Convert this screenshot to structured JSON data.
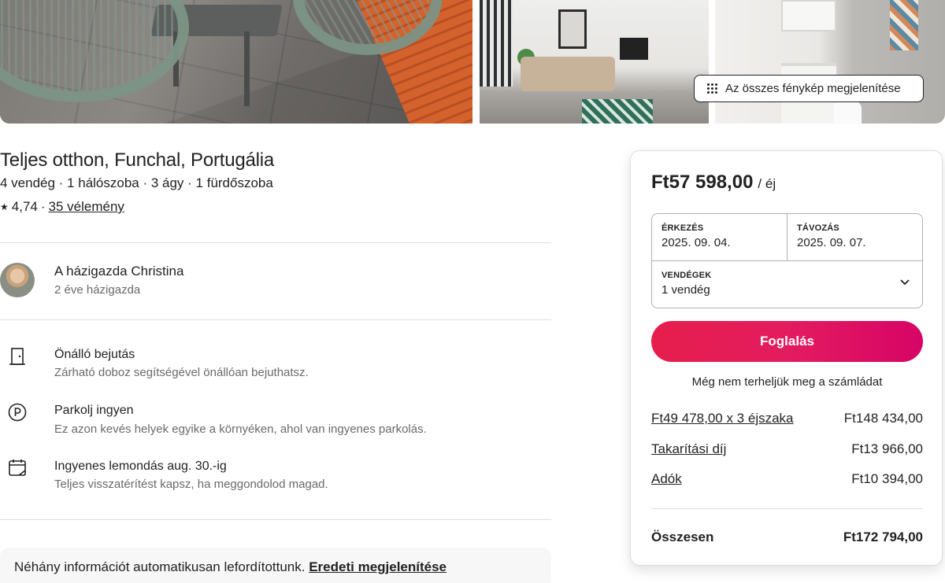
{
  "photos": {
    "show_all_label": "Az összes fénykép megjelenítése"
  },
  "listing": {
    "title": "Teljes otthon, Funchal, Portugália",
    "subtitle": "4 vendég · 1 hálószoba · 3 ágy · 1 fürdőszoba",
    "rating": "4,74",
    "separator": "·",
    "reviews_link": "35 vélemény"
  },
  "host": {
    "name": "A házigazda Christina",
    "tenure": "2 éve házigazda"
  },
  "features": [
    {
      "icon": "door-icon",
      "title": "Önálló bejutás",
      "desc": "Zárható doboz segítségével önállóan bejuthatsz."
    },
    {
      "icon": "parking-icon",
      "title": "Parkolj ingyen",
      "desc": "Ez azon kevés helyek egyike a környéken, ahol van ingyenes parkolás."
    },
    {
      "icon": "calendar-icon",
      "title": "Ingyenes lemondás aug. 30.-ig",
      "desc": "Teljes visszatérítést kapsz, ha meggondolod magad."
    }
  ],
  "translation": {
    "notice": "Néhány információt automatikusan lefordítottunk.",
    "show_original": "Eredeti megjelenítése"
  },
  "booking": {
    "price": "Ft57 598,00",
    "price_unit": "/ éj",
    "checkin_label": "ÉRKEZÉS",
    "checkin_value": "2025. 09. 04.",
    "checkout_label": "TÁVOZÁS",
    "checkout_value": "2025. 09. 07.",
    "guests_label": "VENDÉGEK",
    "guests_value": "1 vendég",
    "reserve_label": "Foglalás",
    "no_charge_note": "Még nem terheljük meg a számládat",
    "fees": [
      {
        "label": "Ft49 478,00 x 3 éjszaka",
        "amount": "Ft148 434,00"
      },
      {
        "label": "Takarítási díj",
        "amount": "Ft13 966,00"
      },
      {
        "label": "Adók",
        "amount": "Ft10 394,00"
      }
    ],
    "total_label": "Összesen",
    "total_amount": "Ft172 794,00"
  },
  "colors": {
    "brand": "#e61e4d",
    "text": "#222222",
    "muted": "#6a6a6a",
    "divider": "#dddddd"
  }
}
